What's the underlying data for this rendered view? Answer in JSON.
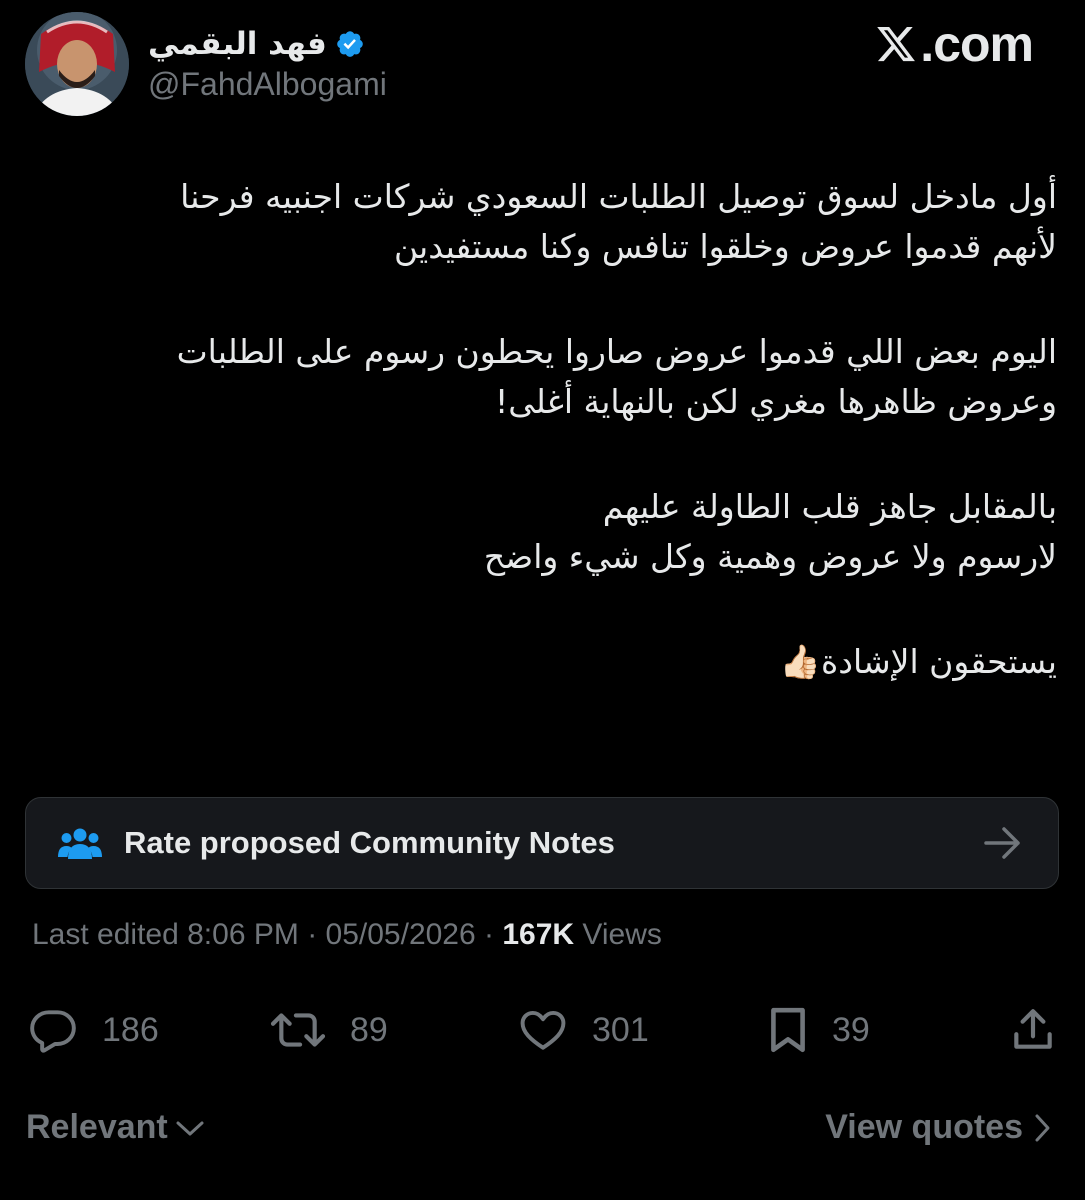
{
  "author": {
    "display_name": "فهد البقمي",
    "handle": "@FahdAlbogami",
    "verified": true
  },
  "brand": {
    "logo_text": ".com",
    "logo_mark": "x-logo-icon"
  },
  "tweet": {
    "paragraphs": [
      "أول مادخل لسوق توصيل الطلبات السعودي شركات اجنبيه فرحنا\nلأنهم قدموا عروض وخلقوا تنافس وكنا مستفيدين",
      "اليوم بعض اللي قدموا عروض صاروا يحطون رسوم على الطلبات\nوعروض ظاهرها مغري لكن بالنهاية أغلى!",
      "بالمقابل جاهز قلب الطاولة عليهم\nلارسوم ولا عروض وهمية وكل شيء واضح",
      "يستحقون الإشادة👍🏻"
    ]
  },
  "community_notes": {
    "label": "Rate proposed Community Notes",
    "icon": "people-icon",
    "arrow": "arrow-right-icon"
  },
  "meta": {
    "edited_prefix": "Last edited ",
    "time": "8:06 PM",
    "separator": " · ",
    "date": "05/05/2026",
    "views_count": "167K",
    "views_label": " Views"
  },
  "actions": {
    "replies": "186",
    "reposts": "89",
    "likes": "301",
    "bookmarks": "39"
  },
  "footer": {
    "sort_label": "Relevant",
    "view_quotes_label": "View quotes"
  },
  "colors": {
    "background": "#000000",
    "text_primary": "#e7e9ea",
    "text_secondary": "#71767b",
    "verified_blue": "#1d9bf0",
    "card_background": "#16181c",
    "people_icon_blue": "#1d9bf0"
  }
}
